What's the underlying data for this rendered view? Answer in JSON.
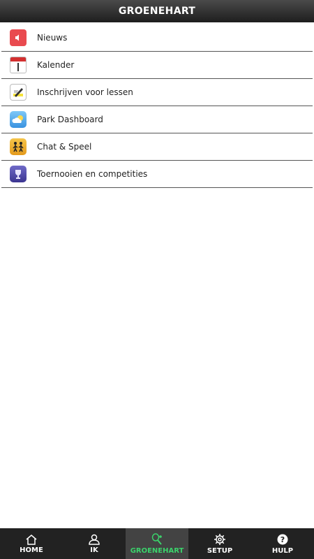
{
  "header": {
    "title": "GROENEHART"
  },
  "menu": {
    "items": [
      {
        "label": "Nieuws",
        "icon": "speaker-icon"
      },
      {
        "label": "Kalender",
        "icon": "calendar-icon"
      },
      {
        "label": "Inschrijven voor lessen",
        "icon": "signup-icon"
      },
      {
        "label": "Park Dashboard",
        "icon": "weather-cloud-icon"
      },
      {
        "label": "Chat & Speel",
        "icon": "players-icon"
      },
      {
        "label": "Toernooien en competities",
        "icon": "trophy-icon"
      }
    ]
  },
  "tabbar": {
    "tabs": [
      {
        "label": "HOME",
        "icon": "home-icon",
        "active": false
      },
      {
        "label": "IK",
        "icon": "person-icon",
        "active": false
      },
      {
        "label": "GROENEHART",
        "icon": "tennis-racket-icon",
        "active": true
      },
      {
        "label": "SETUP",
        "icon": "gear-icon",
        "active": false
      },
      {
        "label": "HULP",
        "icon": "help-icon",
        "active": false
      }
    ],
    "active_color": "#3bd26b"
  }
}
